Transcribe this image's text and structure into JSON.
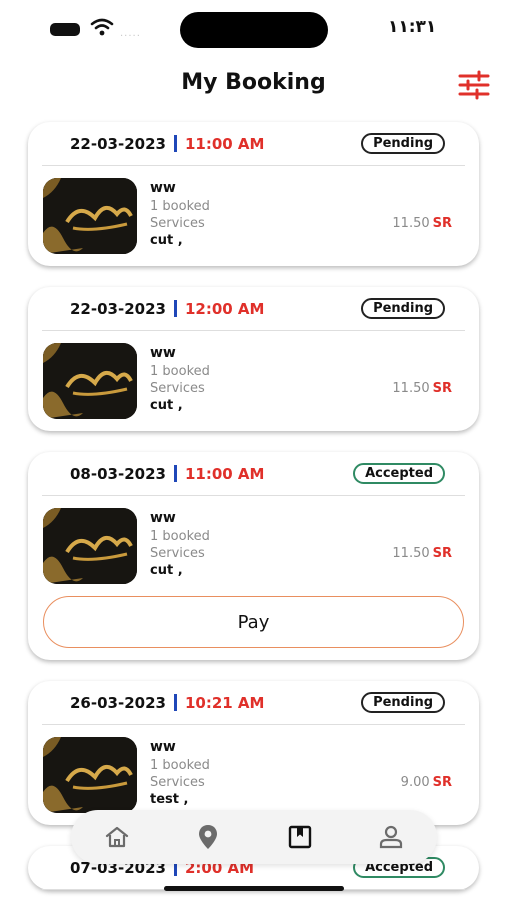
{
  "status_bar": {
    "time": "١١:٣١",
    "dots": "....."
  },
  "header": {
    "title": "My Booking",
    "filter_icon": "filter-sliders-icon"
  },
  "colors": {
    "accent_red": "#e0302a",
    "separator_blue": "#1f47b8",
    "accepted_green": "#2f8a63",
    "pay_border": "#e98f5f"
  },
  "bookings": [
    {
      "date": "22-03-2023",
      "time": "11:00 AM",
      "status": "Pending",
      "salon": "ww",
      "booked": "1 booked",
      "services_label": "Services",
      "services": "cut ,",
      "price": "11.50",
      "currency": "SR"
    },
    {
      "date": "22-03-2023",
      "time": "12:00 AM",
      "status": "Pending",
      "salon": "ww",
      "booked": "1 booked",
      "services_label": "Services",
      "services": "cut ,",
      "price": "11.50",
      "currency": "SR"
    },
    {
      "date": "08-03-2023",
      "time": "11:00 AM",
      "status": "Accepted",
      "salon": "ww",
      "booked": "1 booked",
      "services_label": "Services",
      "services": "cut ,",
      "price": "11.50",
      "currency": "SR",
      "action": "Pay"
    },
    {
      "date": "26-03-2023",
      "time": "10:21 AM",
      "status": "Pending",
      "salon": "ww",
      "booked": "1 booked",
      "services_label": "Services",
      "services": "test ,",
      "price": "9.00",
      "currency": "SR"
    },
    {
      "date": "07-03-2023",
      "time": "2:00 AM",
      "status": "Accepted"
    }
  ],
  "bottom_nav": {
    "items": [
      {
        "icon": "home-icon",
        "active": false
      },
      {
        "icon": "location-pin-icon",
        "active": false
      },
      {
        "icon": "bookmark-icon",
        "active": true
      },
      {
        "icon": "profile-icon",
        "active": false
      }
    ]
  }
}
